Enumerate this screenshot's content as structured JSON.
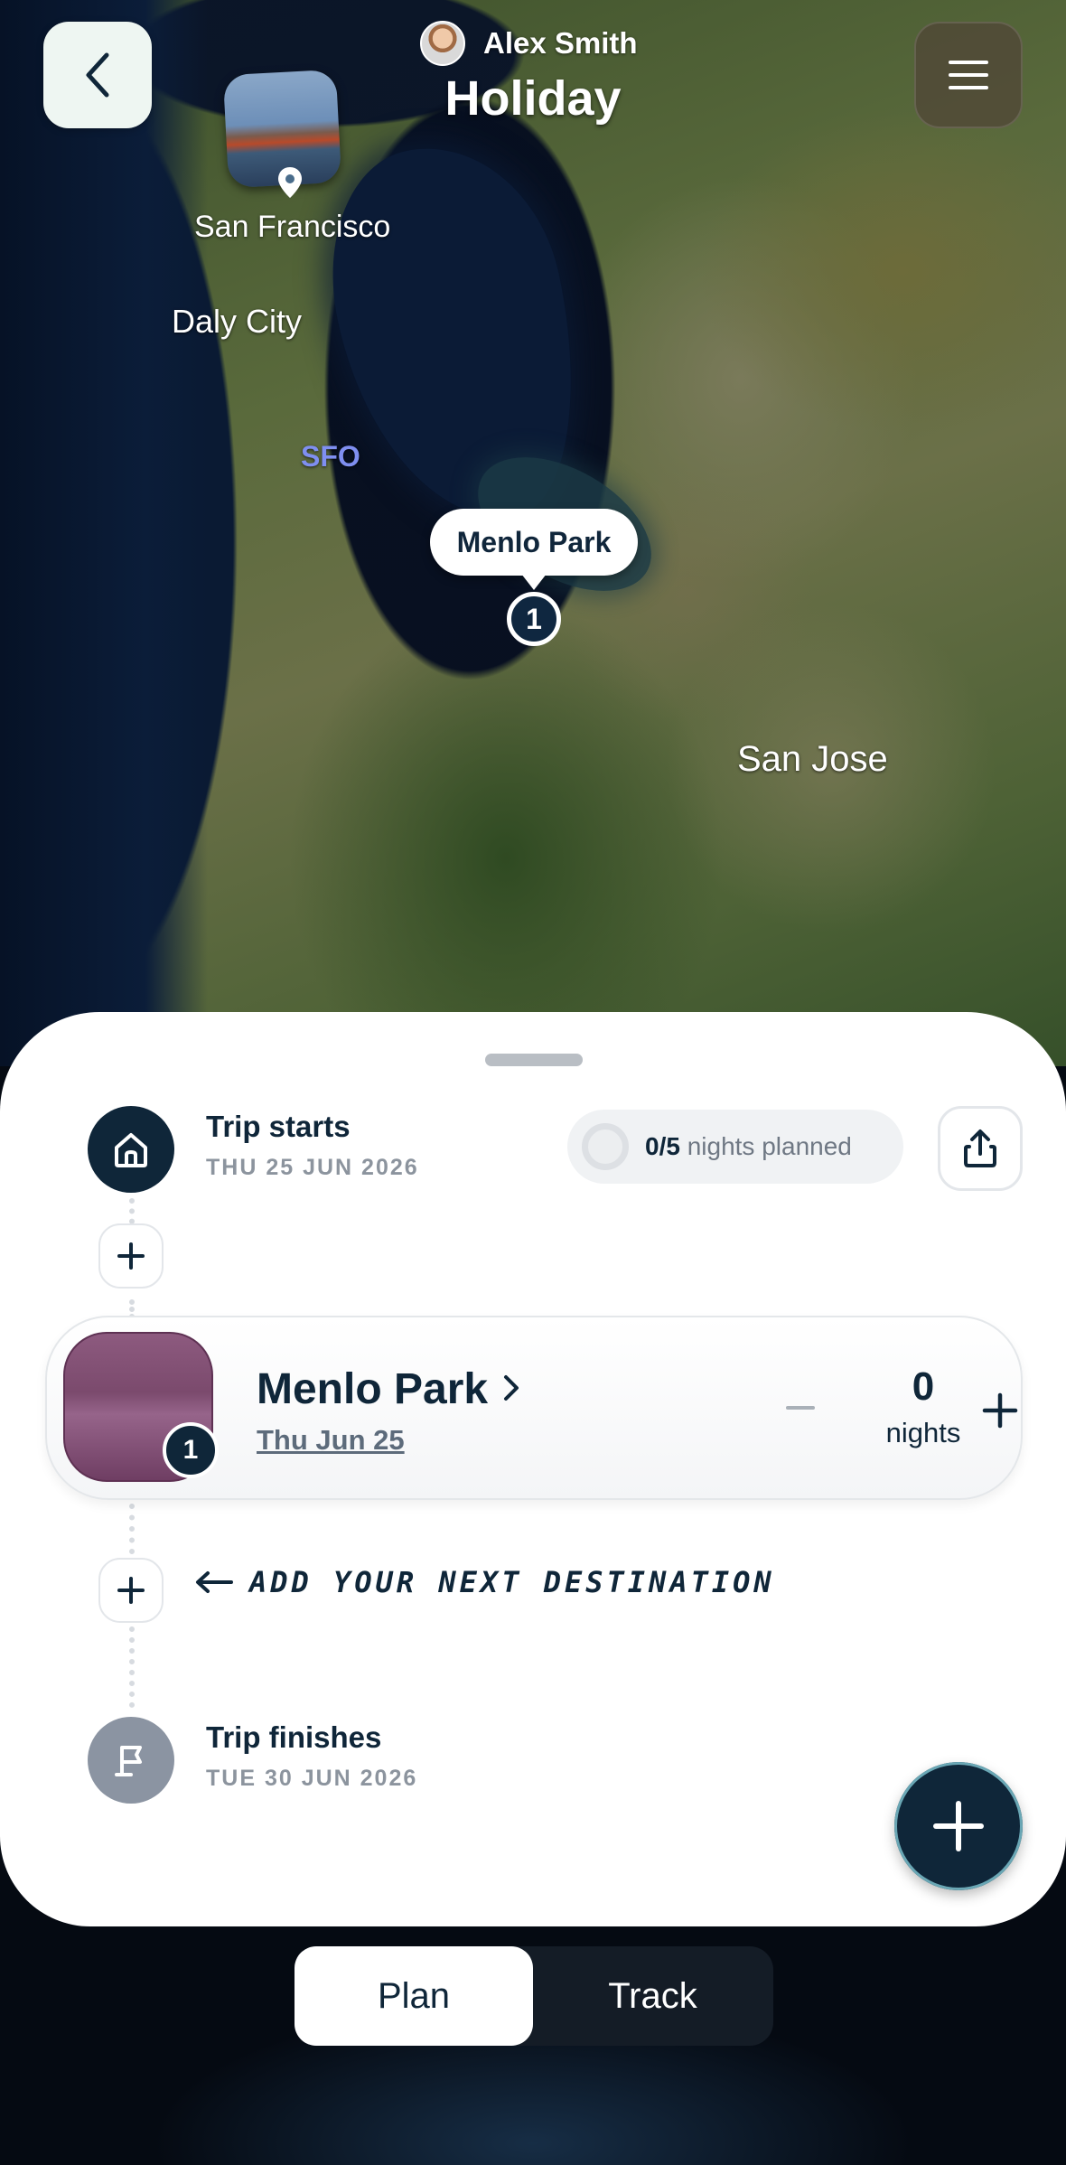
{
  "header": {
    "user_name": "Alex Smith",
    "trip_title": "Holiday"
  },
  "map": {
    "labels": {
      "san_francisco": "San Francisco",
      "daly_city": "Daly City",
      "sfo": "SFO",
      "san_jose": "San Jose"
    },
    "marker": {
      "name": "Menlo Park",
      "index": "1"
    }
  },
  "sheet": {
    "start": {
      "title": "Trip starts",
      "date": "THU 25 JUN 2026"
    },
    "progress": {
      "count": "0/5",
      "label": "nights planned",
      "fraction": 0
    },
    "destination": {
      "name": "Menlo Park",
      "date": "Thu Jun 25",
      "index": "1",
      "nights": "0",
      "nights_label": "nights"
    },
    "hint": "ADD YOUR NEXT DESTINATION",
    "finish": {
      "title": "Trip finishes",
      "date": "TUE 30 JUN 2026"
    }
  },
  "tabs": {
    "items": [
      "Plan",
      "Track"
    ],
    "active": "Plan"
  },
  "colors": {
    "navy": "#0f2639",
    "sfo_label": "#7f8ff0",
    "destination_thumb": "#8d5a7f"
  },
  "icons": [
    "chevron-left-icon",
    "hamburger-menu-icon",
    "map-pin-icon",
    "home-icon",
    "share-icon",
    "plus-icon",
    "minus-icon",
    "chevron-right-icon",
    "arrow-left-icon",
    "flag-icon"
  ]
}
